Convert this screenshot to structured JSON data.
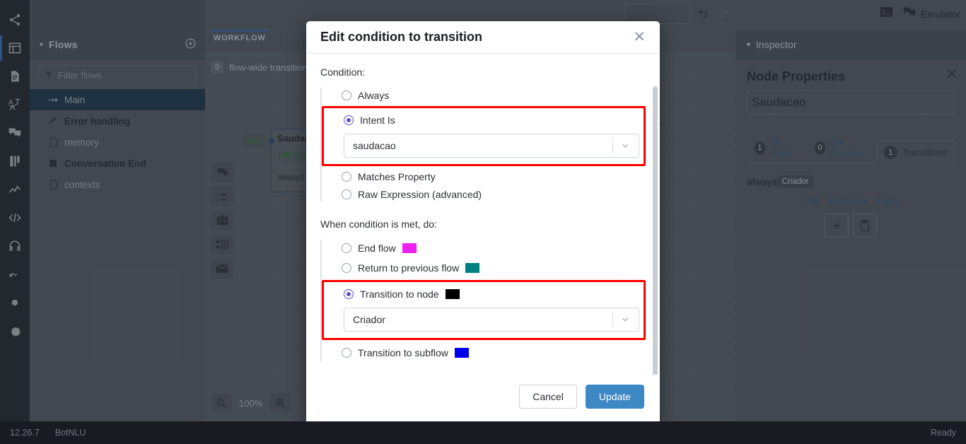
{
  "app": {
    "status_bar": {
      "version": "12.26.7",
      "module": "BotNLU",
      "state": "Ready"
    },
    "topbar": {
      "emulator_label": "Emulator",
      "terminal_icon": "terminal-icon",
      "emulator_icon": "chat-icon",
      "undo_icon": "undo-icon",
      "redo_icon": "redo-icon"
    }
  },
  "icon_rail": {
    "items": [
      {
        "name": "share-nodes-icon"
      },
      {
        "name": "layout-panel-icon"
      },
      {
        "name": "document-icon"
      },
      {
        "name": "translate-icon"
      },
      {
        "name": "chat-bubbles-icon"
      },
      {
        "name": "book-icon"
      },
      {
        "name": "analytics-chart-icon"
      },
      {
        "name": "code-icon"
      },
      {
        "name": "headset-icon"
      },
      {
        "name": "activity-icon"
      },
      {
        "name": "circle-icon"
      },
      {
        "name": "gear-icon"
      }
    ]
  },
  "flows": {
    "header": "Flows",
    "add_icon": "plus-circle-icon",
    "filter_placeholder": "Filter flows",
    "filter_icon": "funnel-icon",
    "items": [
      {
        "label": "Main",
        "icon": "arrow-node-icon",
        "selected": true
      },
      {
        "label": "Error handling",
        "icon": "branch-icon",
        "selected": false
      },
      {
        "label": "memory",
        "icon": "file-icon",
        "selected": false
      },
      {
        "label": "Conversation End",
        "icon": "square-icon",
        "selected": false
      },
      {
        "label": "contexts",
        "icon": "file-icon",
        "selected": false
      }
    ]
  },
  "workflow": {
    "tab_label": "WORKFLOW",
    "flow_wide_count": "0",
    "flow_wide_label": "flow-wide transitions",
    "zoom_level": "100%",
    "zoom_out_icon": "zoom-out-icon",
    "zoom_in_icon": "zoom-in-icon",
    "tools": [
      {
        "name": "say-something-icon"
      },
      {
        "name": "choice-icon"
      },
      {
        "name": "execute-code-icon"
      },
      {
        "name": "split-icon"
      },
      {
        "name": "email-icon"
      }
    ],
    "node": {
      "start_label": "Start",
      "title": "Saudacao",
      "chip_label": "Text",
      "chip_icon": "chat-icon",
      "transition_label": "always"
    }
  },
  "inspector": {
    "header": "Inspector",
    "close_icon": "close-icon",
    "title": "Node Properties",
    "node_name": "Saudacao",
    "tabs": [
      {
        "count": "1",
        "label": "On Enter",
        "active": false
      },
      {
        "count": "0",
        "label": "On Receive",
        "active": false
      },
      {
        "count": "1",
        "label": "Transitions",
        "active": true
      }
    ],
    "transition": {
      "condition": "always",
      "target_chip": "Criador",
      "actions": [
        "Edit",
        "Remove",
        "Copy"
      ],
      "add_icon": "plus-icon",
      "paste_icon": "clipboard-icon"
    }
  },
  "modal": {
    "title": "Edit condition to transition",
    "close_icon": "close-icon",
    "condition_label": "Condition:",
    "condition_options": [
      {
        "label": "Always",
        "selected": false,
        "highlighted": false
      },
      {
        "label": "Intent Is",
        "selected": true,
        "highlighted": true
      },
      {
        "label": "Matches Property",
        "selected": false,
        "highlighted": false
      },
      {
        "label": "Raw Expression (advanced)",
        "selected": false,
        "highlighted": false
      }
    ],
    "intent_select": {
      "value": "saudacao",
      "chevron_icon": "chevron-down-icon"
    },
    "action_label": "When condition is met, do:",
    "action_options": [
      {
        "label": "End flow",
        "color": "#ee22ee",
        "selected": false,
        "highlighted": false
      },
      {
        "label": "Return to previous flow",
        "color": "#008080",
        "selected": false,
        "highlighted": false
      },
      {
        "label": "Transition to node",
        "color": "#000000",
        "selected": true,
        "highlighted": true
      },
      {
        "label": "Transition to subflow",
        "color": "#0000ee",
        "selected": false,
        "highlighted": false
      }
    ],
    "node_select": {
      "value": "Criador",
      "chevron_icon": "chevron-down-icon"
    },
    "cancel_label": "Cancel",
    "update_label": "Update",
    "highlight_color": "#ff0000",
    "primary_color": "#3d87c4",
    "radio_accent": "#5b4fd6"
  }
}
